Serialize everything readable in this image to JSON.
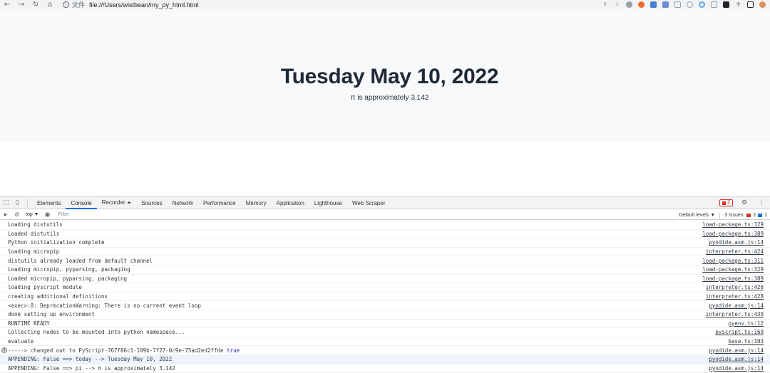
{
  "browser": {
    "nav": {
      "back": "←",
      "forward": "→",
      "reload": "↻",
      "home": "⌂"
    },
    "address": {
      "scheme_label": "文件",
      "url": "file:///Users/wistbean/my_py_html.html"
    },
    "extensions": [
      "share-icon",
      "star-icon",
      "ext-1",
      "ext-2",
      "ext-3",
      "ext-4",
      "ext-5",
      "ext-6",
      "ext-7",
      "ext-8",
      "ext-9",
      "puzzle-icon",
      "sidepanel-icon",
      "profile-avatar"
    ]
  },
  "page": {
    "heading": "Tuesday May 10, 2022",
    "subtitle": "π is approximately 3.142"
  },
  "devtools": {
    "tabs": [
      {
        "label": "Elements",
        "active": false
      },
      {
        "label": "Console",
        "active": true
      },
      {
        "label": "Recorder ⏶",
        "active": false
      },
      {
        "label": "Sources",
        "active": false
      },
      {
        "label": "Network",
        "active": false
      },
      {
        "label": "Performance",
        "active": false
      },
      {
        "label": "Memory",
        "active": false
      },
      {
        "label": "Application",
        "active": false
      },
      {
        "label": "Lighthouse",
        "active": false
      },
      {
        "label": "Web Scraper",
        "active": false
      }
    ],
    "error_count": "2",
    "filter": {
      "context": "top ▼",
      "placeholder": "Filter",
      "levels": "Default levels ▼",
      "issues_label": "3 Issues:",
      "issues_errors": "2",
      "issues_info": "1"
    },
    "console": [
      {
        "msg": "Loading distutils",
        "src": "load-package.ts:329"
      },
      {
        "msg": "Loaded distutils",
        "src": "load-package.ts:389"
      },
      {
        "msg": "Python initialization complete",
        "src": "pyodide.asm.js:14"
      },
      {
        "msg": "loading micropip",
        "src": "interpreter.ts:424"
      },
      {
        "msg": "distutils already loaded from default channel",
        "src": "load-package.ts:311"
      },
      {
        "msg": "Loading micropip, pyparsing, packaging",
        "src": "load-package.ts:329"
      },
      {
        "msg": "Loaded micropip, pyparsing, packaging",
        "src": "load-package.ts:389"
      },
      {
        "msg": "loading pyscript module",
        "src": "interpreter.ts:426"
      },
      {
        "msg": "creating additional definitions",
        "src": "interpreter.ts:428"
      },
      {
        "msg": "<exec>:8: DeprecationWarning: There is no current event loop",
        "src": "pyodide.asm.js:14"
      },
      {
        "msg": "done setting up environment",
        "src": "interpreter.ts:430"
      },
      {
        "msg": "RUNTIME READY",
        "src": "pyenv.ts:12"
      },
      {
        "msg": "Collecting nodes to be mounted into python namespace...",
        "src": "pyscript.ts:169"
      },
      {
        "msg": "evaluate",
        "src": "base.ts:103"
      },
      {
        "msg": "-----> changed out to PyScript-767f86c1-109b-7f27-0c9e-75ad2ed2ffde",
        "msg_tail": "true",
        "src": "pyodide.asm.js:14",
        "badge": "2"
      },
      {
        "msg": "APPENDING: False ==> today --> Tuesday May 10, 2022",
        "src": "pyodide.asm.js:14",
        "highlight": true
      },
      {
        "msg": "APPENDING: False ==> pi --> π is approximately 3.142",
        "src": "pyodide.asm.js:14"
      }
    ]
  }
}
